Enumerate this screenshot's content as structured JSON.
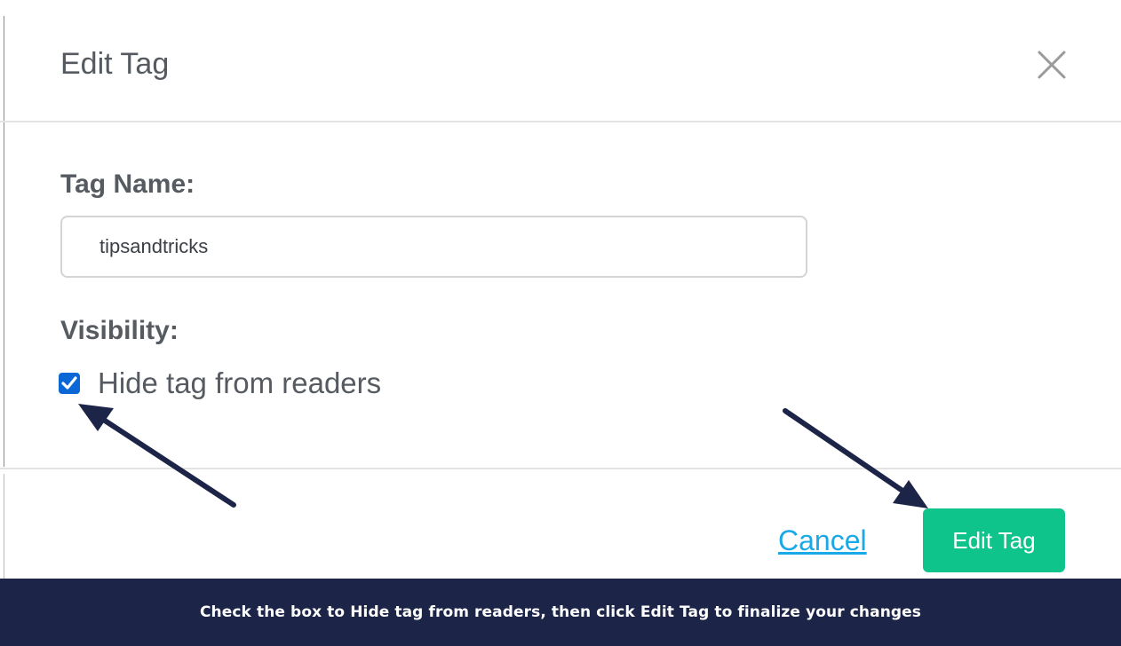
{
  "modal": {
    "title": "Edit Tag",
    "close_icon": "close-icon"
  },
  "form": {
    "tag_name_label": "Tag Name:",
    "tag_name_value": "tipsandtricks",
    "visibility_label": "Visibility:",
    "hide_checkbox": {
      "label": "Hide tag from readers",
      "checked": true
    }
  },
  "footer": {
    "cancel_label": "Cancel",
    "submit_label": "Edit Tag"
  },
  "annotations": {
    "arrow_icon": "arrow-icon",
    "caption": "Check the box to Hide tag from readers, then click Edit Tag to finalize your changes"
  },
  "colors": {
    "primary_button": "#0fc48a",
    "link": "#1aa9e8",
    "checkbox": "#0b67d6",
    "caption_bg": "#1c2548",
    "arrow": "#1c2548"
  }
}
